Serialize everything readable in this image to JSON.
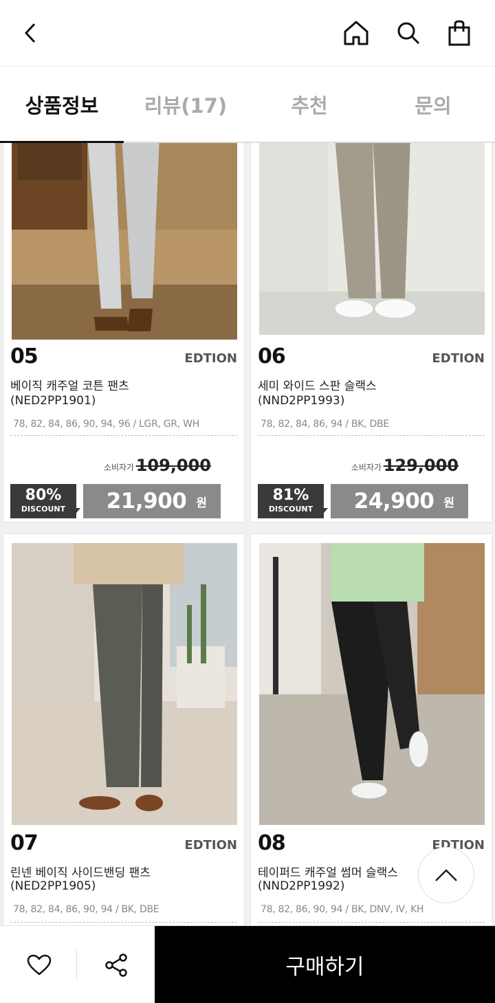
{
  "header": {
    "back_icon": "chevron-left-icon",
    "home_icon": "home-icon",
    "search_icon": "search-icon",
    "bag_icon": "shopping-bag-icon"
  },
  "tabs": [
    {
      "label": "상품정보",
      "active": true
    },
    {
      "label": "리뷰(17)",
      "active": false
    },
    {
      "label": "추천",
      "active": false
    },
    {
      "label": "문의",
      "active": false
    }
  ],
  "products": [
    {
      "number": "05",
      "brand": "EDTION",
      "name": "베이직 캐주얼 코튼 팬츠",
      "code": "(NED2PP1901)",
      "sizes": "78, 82, 84, 86, 90, 94, 96 / LGR, GR, WH",
      "consumer_label": "소비자가",
      "consumer_price": "109,000",
      "discount_pct": "80%",
      "discount_label": "DISCOUNT",
      "price": "21,900",
      "currency": "원"
    },
    {
      "number": "06",
      "brand": "EDTION",
      "name": "세미 와이드 스판 슬랙스",
      "code": "(NND2PP1993)",
      "sizes": "78, 82, 84, 86, 94 / BK, DBE",
      "consumer_label": "소비자가",
      "consumer_price": "129,000",
      "discount_pct": "81%",
      "discount_label": "DISCOUNT",
      "price": "24,900",
      "currency": "원"
    },
    {
      "number": "07",
      "brand": "EDTION",
      "name": "린넨 베이직 사이드밴딩 팬츠",
      "code": "(NED2PP1905)",
      "sizes": "78, 82, 84, 86, 90, 94 / BK, DBE"
    },
    {
      "number": "08",
      "brand": "EDTION",
      "name": "테이퍼드 캐주얼 썸머 슬랙스",
      "code": "(NND2PP1992)",
      "sizes": "78, 82, 86, 90, 94 / BK, DNV, IV, KH"
    }
  ],
  "scroll_top_icon": "chevron-up-icon",
  "bottom_bar": {
    "wishlist_icon": "heart-icon",
    "share_icon": "share-icon",
    "buy_label": "구매하기"
  }
}
